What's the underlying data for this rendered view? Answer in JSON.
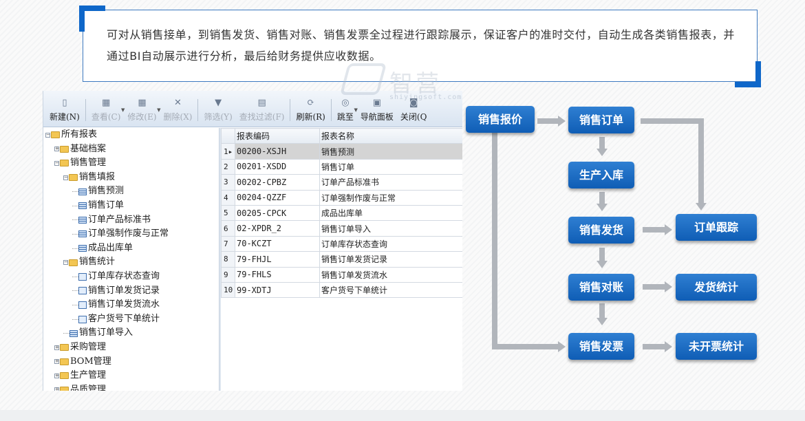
{
  "intro": {
    "text": "可对从销售接单，到销售发货、销售对账、销售发票全过程进行跟踪展示，保证客户的准时交付，自动生成各类销售报表，并通过BI自动展示进行分析，最后给财务提供应收数据。"
  },
  "watermark": {
    "text": "智营",
    "sub": "shiyingsoft.com"
  },
  "toolbar": {
    "buttons": [
      {
        "label": "新建(N)",
        "icon": "new-doc-icon",
        "enabled": true
      },
      {
        "label": "查看(C)",
        "icon": "view-icon",
        "enabled": false
      },
      {
        "label": "修改(E)",
        "icon": "edit-icon",
        "enabled": false
      },
      {
        "label": "删除(X)",
        "icon": "delete-icon",
        "enabled": false
      },
      {
        "label": "筛选(Y)",
        "icon": "filter-icon",
        "enabled": false
      },
      {
        "label": "查找过滤(F)",
        "icon": "find-filter-icon",
        "enabled": false
      },
      {
        "label": "刷新(R)",
        "icon": "refresh-icon",
        "enabled": true
      },
      {
        "label": "跳至",
        "icon": "jump-icon",
        "enabled": true
      },
      {
        "label": "导航面板",
        "icon": "nav-panel-icon",
        "enabled": true
      },
      {
        "label": "关闭(Q",
        "icon": "close-icon",
        "enabled": true
      }
    ]
  },
  "tree": {
    "items": [
      {
        "label": "所有报表",
        "level": 0,
        "type": "folder",
        "toggle": "−"
      },
      {
        "label": "基础档案",
        "level": 1,
        "type": "folder",
        "toggle": "+"
      },
      {
        "label": "销售管理",
        "level": 1,
        "type": "folder",
        "toggle": "−"
      },
      {
        "label": "销售填报",
        "level": 2,
        "type": "folder",
        "toggle": "−"
      },
      {
        "label": "销售预测",
        "level": 3,
        "type": "table",
        "toggle": ""
      },
      {
        "label": "销售订单",
        "level": 3,
        "type": "table",
        "toggle": ""
      },
      {
        "label": "订单产品标准书",
        "level": 3,
        "type": "table",
        "toggle": ""
      },
      {
        "label": "订单强制作废与正常",
        "level": 3,
        "type": "table",
        "toggle": ""
      },
      {
        "label": "成品出库单",
        "level": 3,
        "type": "table",
        "toggle": ""
      },
      {
        "label": "销售统计",
        "level": 2,
        "type": "folder",
        "toggle": "−"
      },
      {
        "label": "订单库存状态查询",
        "level": 3,
        "type": "report",
        "toggle": ""
      },
      {
        "label": "销售订单发货记录",
        "level": 3,
        "type": "report",
        "toggle": ""
      },
      {
        "label": "销售订单发货流水",
        "level": 3,
        "type": "report",
        "toggle": ""
      },
      {
        "label": "客户货号下单统计",
        "level": 3,
        "type": "report",
        "toggle": ""
      },
      {
        "label": "销售订单导入",
        "level": 2,
        "type": "table",
        "toggle": ""
      },
      {
        "label": "采购管理",
        "level": 1,
        "type": "folder",
        "toggle": "+"
      },
      {
        "label": "BOM管理",
        "level": 1,
        "type": "folder",
        "toggle": "+"
      },
      {
        "label": "生产管理",
        "level": 1,
        "type": "folder",
        "toggle": "+"
      },
      {
        "label": "品质管理",
        "level": 1,
        "type": "folder",
        "toggle": "+"
      }
    ]
  },
  "grid": {
    "headers": [
      "报表编码",
      "报表名称"
    ],
    "rows": [
      {
        "n": "1",
        "code": "00200-XSJH",
        "name": "销售预测",
        "selected": true
      },
      {
        "n": "2",
        "code": "00201-XSDD",
        "name": "销售订单"
      },
      {
        "n": "3",
        "code": "00202-CPBZ",
        "name": "订单产品标准书"
      },
      {
        "n": "4",
        "code": "00204-QZZF",
        "name": "订单强制作废与正常"
      },
      {
        "n": "5",
        "code": "00205-CPCK",
        "name": "成品出库单"
      },
      {
        "n": "6",
        "code": "02-XPDR_2",
        "name": "销售订单导入"
      },
      {
        "n": "7",
        "code": "70-KCZT",
        "name": "订单库存状态查询"
      },
      {
        "n": "8",
        "code": "79-FHJL",
        "name": "销售订单发货记录"
      },
      {
        "n": "9",
        "code": "79-FHLS",
        "name": "销售订单发货流水"
      },
      {
        "n": "10",
        "code": "99-XDTJ",
        "name": "客户货号下单统计"
      }
    ]
  },
  "flow": {
    "quote": "销售报价",
    "order": "销售订单",
    "production": "生产入库",
    "delivery": "销售发货",
    "tracking": "订单跟踪",
    "reconcile": "销售对账",
    "delivery_stats": "发货统计",
    "invoice": "销售发票",
    "uninvoiced_stats": "未开票统计"
  },
  "colors": {
    "accent": "#0f67c9",
    "box": "#1566c4",
    "arrow": "#b1b5bb"
  }
}
